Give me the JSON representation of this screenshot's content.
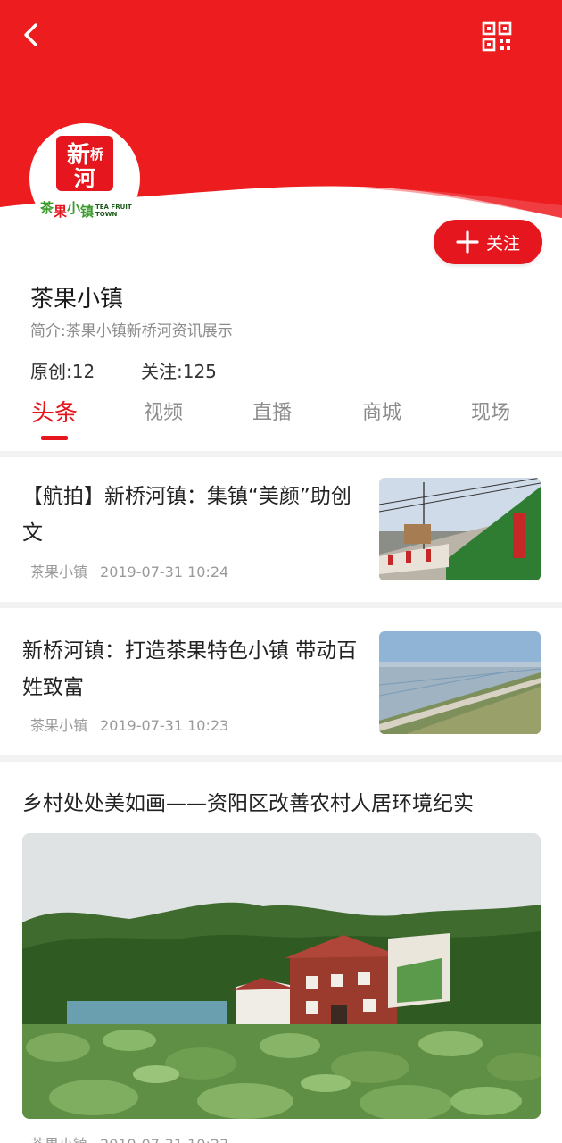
{
  "colors": {
    "brand_red": "#e5161d",
    "text_dark": "#222222",
    "text_muted": "#8c8c8c"
  },
  "header": {
    "back_icon": "chevron-left-icon",
    "qr_icon": "qr-code-icon"
  },
  "profile": {
    "logo_text_main": "新桥河",
    "logo_text_sub": "茶果小镇",
    "logo_text_en": "TEA FRUIT TOWN",
    "follow_label": "关注",
    "name": "茶果小镇",
    "intro": "简介:茶果小镇新桥河资讯展示",
    "original_count": "原创:12",
    "follow_count": "关注:125"
  },
  "tabs": [
    {
      "label": "头条",
      "active": true
    },
    {
      "label": "视频",
      "active": false
    },
    {
      "label": "直播",
      "active": false
    },
    {
      "label": "商城",
      "active": false
    },
    {
      "label": "现场",
      "active": false
    }
  ],
  "articles": [
    {
      "title": "【航拍】新桥河镇：集镇“美颜”助创文",
      "source": "茶果小镇",
      "time": "2019-07-31 10:24"
    },
    {
      "title": "新桥河镇：打造茶果特色小镇 带动百姓致富",
      "source": "茶果小镇",
      "time": "2019-07-31 10:23"
    },
    {
      "title": "乡村处处美如画——资阳区改善农村人居环境纪实",
      "source": "茶果小镇",
      "time": "2019-07-31 10:23"
    }
  ]
}
